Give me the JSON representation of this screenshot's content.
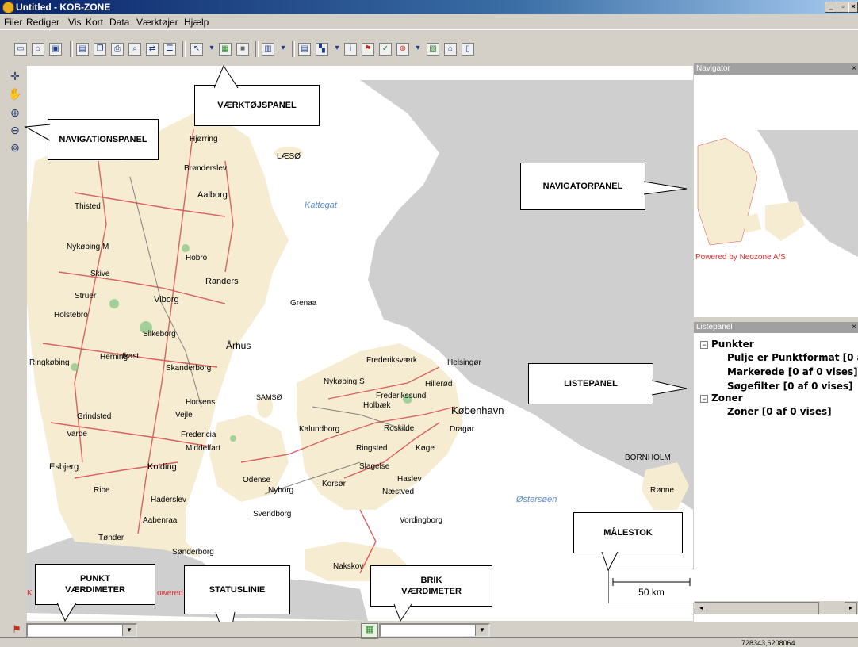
{
  "window": {
    "title": "Untitled - KOB-ZONE"
  },
  "menu": [
    "Filer",
    "Rediger",
    "Vis",
    "Kort",
    "Data",
    "Værktøjer",
    "Hjælp"
  ],
  "callouts": {
    "toolbar": "VÆRKTØJSPANEL",
    "navigation": "NAVIGATIONSPANEL",
    "navigator": "NAVIGATORPANEL",
    "list": "LISTEPANEL",
    "scale": "MÅLESTOK",
    "point_value_line1": "PUNKT",
    "point_value_line2": "VÆRDIMETER",
    "statusline": "STATUSLINIE",
    "tile_value_line1": "BRIK",
    "tile_value_line2": "VÆRDIMETER"
  },
  "navigator": {
    "title": "Navigator",
    "credit": "Powered by Neozone A/S"
  },
  "listpanel": {
    "title": "Listepanel",
    "groups": [
      {
        "label": "Punkter",
        "items": [
          "Pulje er Punktformat [0 af 0",
          "Markerede [0 af 0 vises]",
          "Søgefilter [0 af 0 vises]"
        ]
      },
      {
        "label": "Zoner",
        "items": [
          "Zoner [0 af 0 vises]"
        ]
      }
    ]
  },
  "map": {
    "labels": [
      "Hjørring",
      "Brønderslev",
      "LÆSØ",
      "Kattegat",
      "Aalborg",
      "Thisted",
      "Nykøbing M",
      "Hobro",
      "Skive",
      "Randers",
      "Struer",
      "Viborg",
      "Grenaa",
      "Holstebro",
      "Silkeborg",
      "Herning",
      "Århus",
      "Ringkøbing",
      "Ikast",
      "Skanderborg",
      "Frederiksværk",
      "Helsingør",
      "Nykøbing S",
      "Hillerød",
      "Frederikssund",
      "Holbæk",
      "København",
      "SAMSØ",
      "Horsens",
      "Grindsted",
      "Vejle",
      "Kalundborg",
      "Roskilde",
      "Dragør",
      "Varde",
      "Fredericia",
      "Ringsted",
      "Køge",
      "Middelfart",
      "BORNHOLM",
      "Esbjerg",
      "Kolding",
      "Slagelse",
      "Haslev",
      "Rønne",
      "Odense",
      "Nyborg",
      "Korsør",
      "Næstved",
      "Ribe",
      "Haderslev",
      "Østersøen",
      "Svendborg",
      "Vordingborg",
      "Aabenraa",
      "Tønder",
      "Sønderborg",
      "Nakskov"
    ],
    "scale": "50 km",
    "credit_fragment": "owered",
    "credit_fragment_left": "K"
  },
  "status": {
    "coords": "728343,6208064"
  },
  "colors": {
    "land": "#f5ecd2",
    "sea": "#ffffff",
    "foreign": "#c8c8c8",
    "road": "#d44a4a",
    "callout_border": "#000000"
  }
}
